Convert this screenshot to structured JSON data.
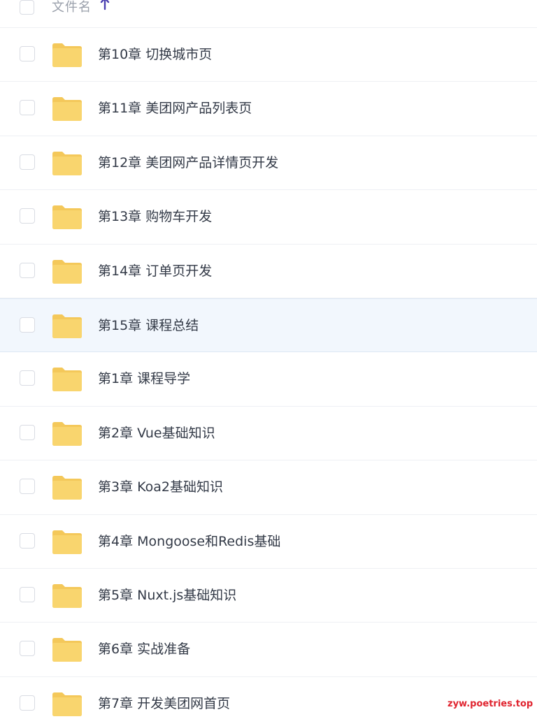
{
  "header": {
    "column_label": "文件名",
    "sort_direction": "ascending",
    "sort_icon": "arrow-up-icon",
    "accent_color": "#4a3fb0"
  },
  "files": [
    {
      "name": "第10章 切换城市页",
      "type": "folder",
      "selected": false
    },
    {
      "name": "第11章 美团网产品列表页",
      "type": "folder",
      "selected": false
    },
    {
      "name": "第12章 美团网产品详情页开发",
      "type": "folder",
      "selected": false
    },
    {
      "name": "第13章 购物车开发",
      "type": "folder",
      "selected": false
    },
    {
      "name": "第14章 订单页开发",
      "type": "folder",
      "selected": false
    },
    {
      "name": "第15章 课程总结",
      "type": "folder",
      "selected": true
    },
    {
      "name": "第1章 课程导学",
      "type": "folder",
      "selected": false
    },
    {
      "name": "第2章 Vue基础知识",
      "type": "folder",
      "selected": false
    },
    {
      "name": "第3章 Koa2基础知识",
      "type": "folder",
      "selected": false
    },
    {
      "name": "第4章 Mongoose和Redis基础",
      "type": "folder",
      "selected": false
    },
    {
      "name": "第5章 Nuxt.js基础知识",
      "type": "folder",
      "selected": false
    },
    {
      "name": "第6章 实战准备",
      "type": "folder",
      "selected": false
    },
    {
      "name": "第7章 开发美团网首页",
      "type": "folder",
      "selected": false
    }
  ],
  "colors": {
    "folder": "#f9d56e",
    "folder_tab": "#f4c85a",
    "selected_row_bg": "#f2f7fd",
    "text": "#333a47",
    "watermark": "#e0242f"
  },
  "watermark": "zyw.poetries.top"
}
